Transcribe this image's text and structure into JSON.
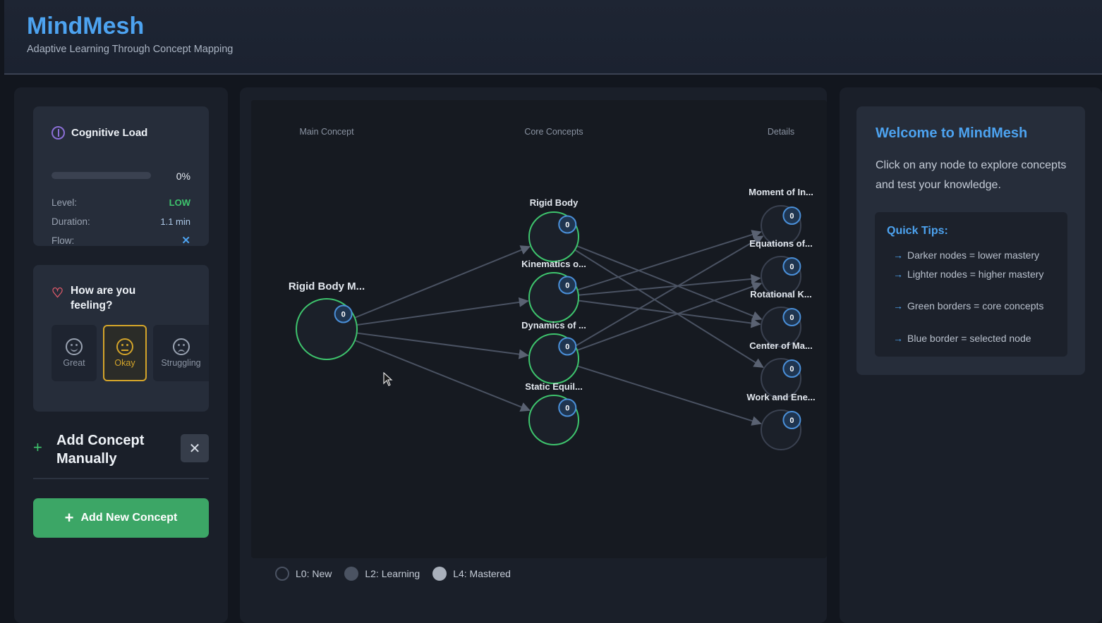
{
  "app": {
    "title": "MindMesh",
    "subtitle": "Adaptive Learning Through Concept Mapping"
  },
  "cognitive_load": {
    "title": "Cognitive Load",
    "percent_label": "0%",
    "percent": 0,
    "level_label": "Level:",
    "level_value": "LOW",
    "duration_label": "Duration:",
    "duration_value": "1.1 min",
    "flow_label": "Flow:",
    "flow_value": "✕"
  },
  "feeling": {
    "title": "How are you feeling?",
    "options": [
      "Great",
      "Okay",
      "Struggling"
    ],
    "selected": "Okay"
  },
  "add_manual": {
    "title": "Add Concept Manually",
    "close_label": "✕"
  },
  "add_new_button": "Add New Concept",
  "graph": {
    "columns": [
      "Main Concept",
      "Core Concepts",
      "Details"
    ],
    "nodes": [
      {
        "id": "main",
        "label": "Rigid Body M...",
        "badge": "0",
        "border": "#3ec46d"
      },
      {
        "id": "c1",
        "label": "Rigid Body",
        "badge": "0",
        "border": "#3ec46d"
      },
      {
        "id": "c2",
        "label": "Kinematics o...",
        "badge": "0",
        "border": "#3ec46d"
      },
      {
        "id": "c3",
        "label": "Dynamics of ...",
        "badge": "0",
        "border": "#3ec46d"
      },
      {
        "id": "c4",
        "label": "Static Equil...",
        "badge": "0",
        "border": "#3ec46d"
      },
      {
        "id": "d1",
        "label": "Moment of In...",
        "badge": "0",
        "border": "#3a4150"
      },
      {
        "id": "d2",
        "label": "Equations of...",
        "badge": "0",
        "border": "#3a4150"
      },
      {
        "id": "d3",
        "label": "Rotational K...",
        "badge": "0",
        "border": "#3a4150"
      },
      {
        "id": "d4",
        "label": "Center of Ma...",
        "badge": "0",
        "border": "#3a4150"
      },
      {
        "id": "d5",
        "label": "Work and Ene...",
        "badge": "0",
        "border": "#3a4150"
      }
    ],
    "edges": [
      [
        "main",
        "c1"
      ],
      [
        "main",
        "c2"
      ],
      [
        "main",
        "c3"
      ],
      [
        "main",
        "c4"
      ],
      [
        "c1",
        "d3"
      ],
      [
        "c1",
        "d4"
      ],
      [
        "c2",
        "d1"
      ],
      [
        "c2",
        "d2"
      ],
      [
        "c2",
        "d3"
      ],
      [
        "c3",
        "d1"
      ],
      [
        "c3",
        "d2"
      ],
      [
        "c3",
        "d5"
      ]
    ]
  },
  "legend": [
    "L0: New",
    "L2: Learning",
    "L4: Mastered"
  ],
  "welcome": {
    "title": "Welcome to MindMesh",
    "text": "Click on any node to explore concepts and test your knowledge.",
    "tips_title": "Quick Tips:",
    "tips": [
      "Darker nodes = lower mastery",
      "Lighter nodes = higher mastery",
      "Green borders = core concepts",
      "Blue border = selected node"
    ]
  },
  "colors": {
    "accent": "#4da3f0",
    "success": "#3ec46d",
    "warning": "#d4a52a",
    "add_button": "#3ca666"
  }
}
